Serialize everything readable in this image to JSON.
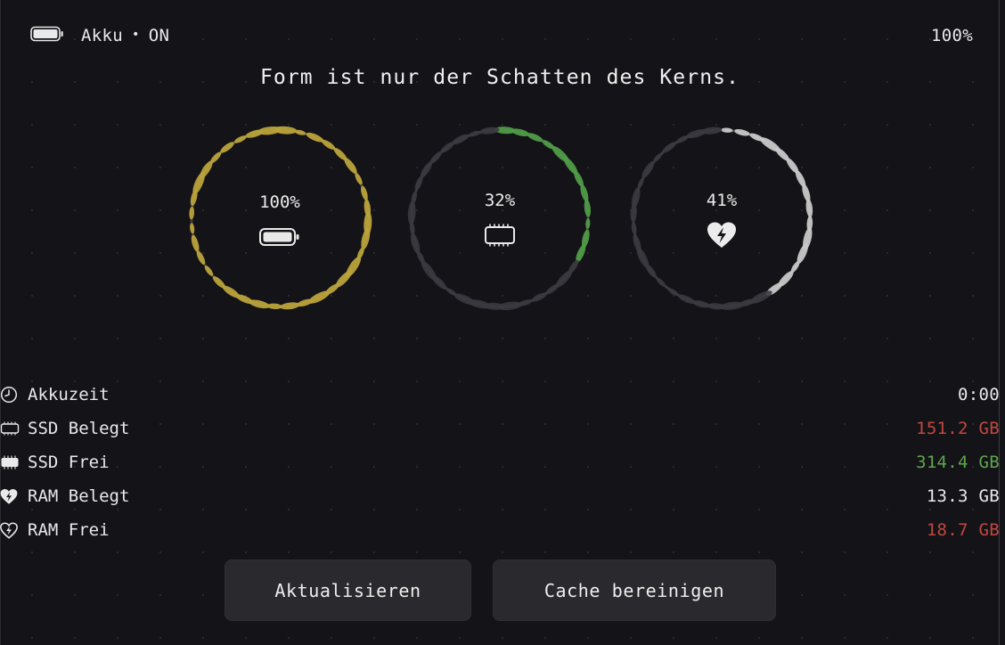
{
  "colors": {
    "background": "#141318",
    "accent_gold": "#b9a23a",
    "accent_green": "#4f9b47",
    "accent_silver": "#c7c7c7",
    "track": "#3b3a3f",
    "value_red": "#c0483f",
    "value_green": "#5ea64f",
    "value_default": "#e9e9ea"
  },
  "status": {
    "battery_icon": "battery-full-icon",
    "label": "Akku",
    "separator": "•",
    "state": "ON",
    "percent": "100%"
  },
  "quote": "Form ist nur der Schatten des Kerns.",
  "gauges": [
    {
      "id": "battery",
      "value_text": "100%",
      "fraction": 1.0,
      "color": "#b9a23a",
      "icon": "battery-full-icon"
    },
    {
      "id": "cpu",
      "value_text": "32%",
      "fraction": 0.32,
      "color": "#4f9b47",
      "icon": "chip-icon"
    },
    {
      "id": "health",
      "value_text": "41%",
      "fraction": 0.41,
      "color": "#c7c7c7",
      "icon": "heart-bolt-icon"
    }
  ],
  "stats": [
    {
      "icon": "clock-icon",
      "label": "Akkuzeit",
      "value": "0:00",
      "value_color": "#e9e9ea"
    },
    {
      "icon": "chip-outline-icon",
      "label": "SSD Belegt",
      "value": "151.2 GB",
      "value_color": "#c0483f"
    },
    {
      "icon": "chip-filled-icon",
      "label": "SSD Frei",
      "value": "314.4 GB",
      "value_color": "#5ea64f"
    },
    {
      "icon": "heart-bolt-filled-icon",
      "label": "RAM Belegt",
      "value": "13.3 GB",
      "value_color": "#e9e9ea"
    },
    {
      "icon": "heart-bolt-outline-icon",
      "label": "RAM Frei",
      "value": "18.7 GB",
      "value_color": "#c0483f"
    }
  ],
  "buttons": {
    "refresh_label": "Aktualisieren",
    "clean_label": "Cache bereinigen"
  }
}
